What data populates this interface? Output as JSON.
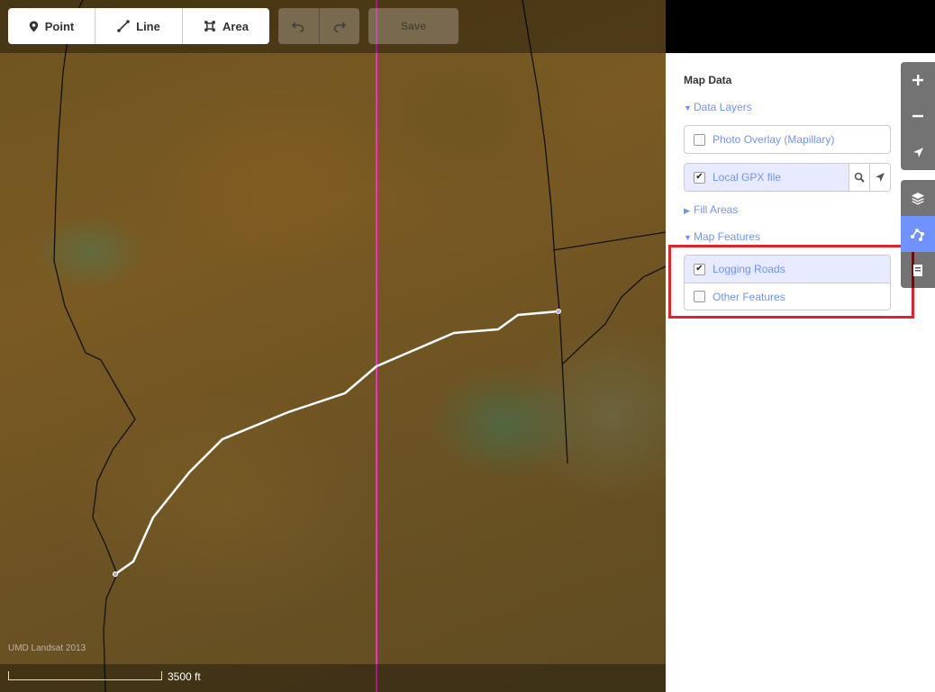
{
  "toolbar": {
    "point_label": "Point",
    "line_label": "Line",
    "area_label": "Area",
    "save_label": "Save"
  },
  "map": {
    "attribution": "UMD Landsat 2013",
    "scale_label": "3500 ft"
  },
  "panel": {
    "title": "Map Data",
    "data_layers": {
      "heading": "Data Layers",
      "expanded": true,
      "items": [
        {
          "label": "Photo Overlay (Mapillary)",
          "checked": false
        },
        {
          "label": "Local GPX file",
          "checked": true
        }
      ]
    },
    "fill_areas": {
      "heading": "Fill Areas",
      "expanded": false
    },
    "map_features": {
      "heading": "Map Features",
      "expanded": true,
      "items": [
        {
          "label": "Logging Roads",
          "checked": true
        },
        {
          "label": "Other Features",
          "checked": false
        }
      ]
    }
  },
  "colors": {
    "accent": "#7092ff",
    "highlight": "#e3232c",
    "gpx_track": "#ff26d4"
  },
  "icons": [
    "map-pin-icon",
    "line-icon",
    "area-icon",
    "undo-icon",
    "redo-icon",
    "zoom-in-icon",
    "zoom-out-icon",
    "geolocate-icon",
    "layers-icon",
    "map-data-icon",
    "help-icon",
    "search-icon"
  ]
}
